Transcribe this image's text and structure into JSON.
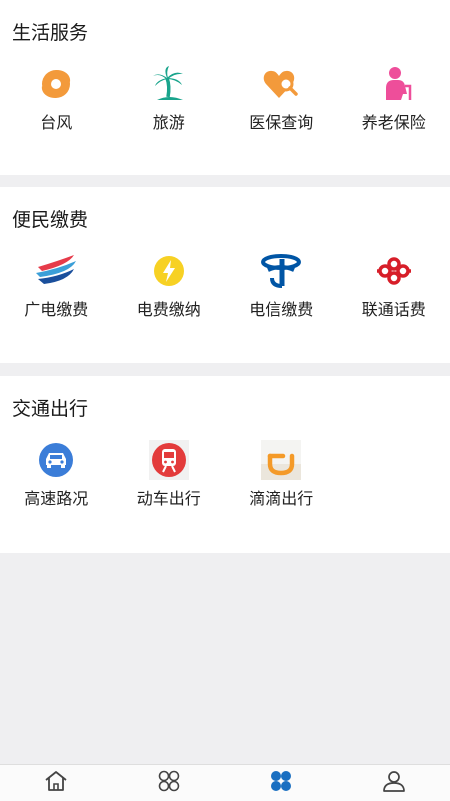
{
  "sections": [
    {
      "title": "生活服务",
      "items": [
        {
          "label": "台风",
          "icon": "typhoon-icon"
        },
        {
          "label": "旅游",
          "icon": "palm-tree-icon"
        },
        {
          "label": "医保查询",
          "icon": "heart-search-icon"
        },
        {
          "label": "养老保险",
          "icon": "elderly-person-icon"
        }
      ]
    },
    {
      "title": "便民缴费",
      "items": [
        {
          "label": "广电缴费",
          "icon": "broadcast-logo-icon"
        },
        {
          "label": "电费缴纳",
          "icon": "lightning-icon"
        },
        {
          "label": "电信缴费",
          "icon": "china-telecom-logo-icon"
        },
        {
          "label": "联通话费",
          "icon": "china-unicom-logo-icon"
        }
      ]
    },
    {
      "title": "交通出行",
      "items": [
        {
          "label": "高速路况",
          "icon": "car-icon"
        },
        {
          "label": "动车出行",
          "icon": "train-icon"
        },
        {
          "label": "滴滴出行",
          "icon": "didi-logo-icon"
        }
      ]
    }
  ],
  "tabbar": {
    "tabs": [
      {
        "icon": "home-icon",
        "active": false
      },
      {
        "icon": "apps-icon",
        "active": false
      },
      {
        "icon": "services-icon",
        "active": true
      },
      {
        "icon": "profile-icon",
        "active": false
      }
    ],
    "active_color": "#1a6fc1",
    "inactive_color": "#444444"
  },
  "colors": {
    "background": "#efeff1",
    "card": "#ffffff"
  }
}
